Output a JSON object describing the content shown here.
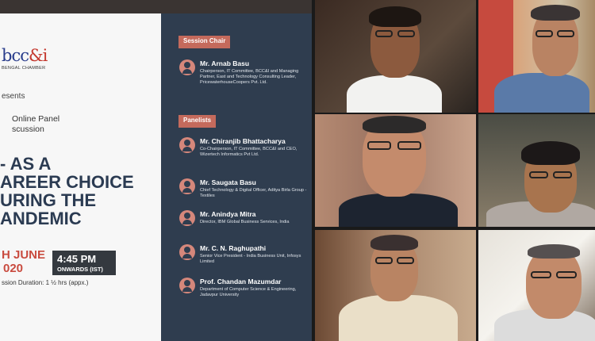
{
  "slide": {
    "logo_mark": "bcc",
    "logo_amp": "&i",
    "logo_sub": "BENGAL CHAMBER",
    "presents": "esents",
    "online_line1": "Online Panel",
    "online_line2": "scussion",
    "headline": "- AS A\nAREER CHOICE\nURING THE\nANDEMIC",
    "date_line1": "H JUNE",
    "date_line2": "020",
    "time": "4:45 PM",
    "time_sub": "ONWARDS (IST)",
    "duration": "ssion Duration: 1 ½ hrs (appx.)",
    "session_chair_label": "Session Chair",
    "panelists_label": "Panelists",
    "chair": {
      "name": "Mr. Arnab Basu",
      "desc": "Chairperson, IT Committee, BCC&I and Managing Partner, East and Technology Consulting Leader, PricewaterhouseCoopers Pvt. Ltd."
    },
    "panelists": [
      {
        "name": "Mr. Chiranjib Bhattacharya",
        "desc": "Co-Chairperson, IT Committee, BCC&I and CEO, Wizertech Informatics Pvt Ltd."
      },
      {
        "name": "Mr. Saugata Basu",
        "desc": "Chief Technology & Digital Officer, Aditya Birla Group - Textiles"
      },
      {
        "name": "Mr. Anindya Mitra",
        "desc": "Director, IBM Global Business Services, India"
      },
      {
        "name": "Mr. C. N. Raghupathi",
        "desc": "Senior Vice President - India Business Unit, Infosys Limited"
      },
      {
        "name": "Prof. Chandan Mazumdar",
        "desc": "Department of Computer Science & Engineering, Jadavpur University"
      }
    ]
  },
  "colors": {
    "panel_dark": "#2f3d4f",
    "tag": "#c46a5c",
    "accent_red": "#c94b3f",
    "headline": "#2b3b52"
  }
}
